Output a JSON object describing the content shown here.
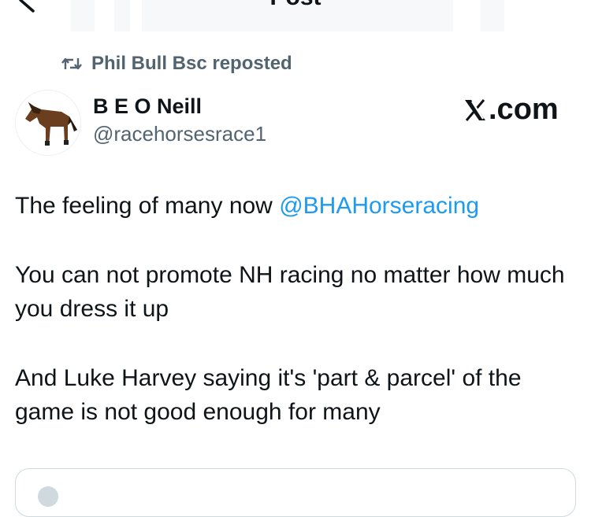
{
  "topbar": {
    "title": "Post",
    "more": "···"
  },
  "repost": {
    "text": "Phil Bull Bsc reposted",
    "icon": "repost-icon"
  },
  "author": {
    "name": "B E O Neill",
    "handle": "@racehorsesrace1",
    "avatar": "horse-avatar"
  },
  "watermark": {
    "text": ".com",
    "icon": "x-logo-icon"
  },
  "post": {
    "line1_text": "The feeling of many now ",
    "line1_mention": "@BHAHorseracing",
    "para2": "You can not promote NH racing no matter how much you dress it up",
    "para3": "And Luke Harvey saying it's 'part & parcel' of the game is not good enough for many"
  },
  "colors": {
    "text": "#0f1419",
    "secondary": "#536471",
    "link": "#1d9bf0",
    "border": "#cfd9de"
  }
}
